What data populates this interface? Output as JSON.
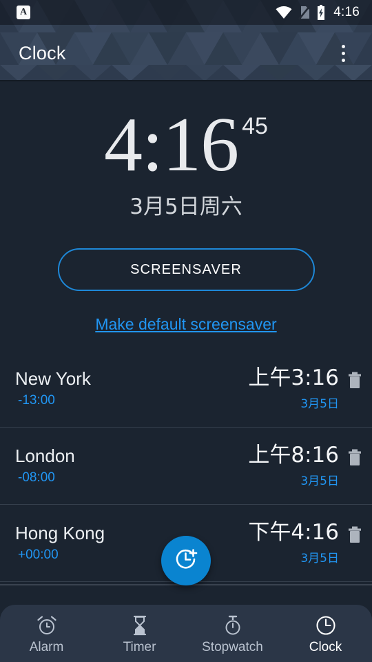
{
  "statusbar": {
    "app_icon": "app-letter-a-icon",
    "icons": [
      "wifi-icon",
      "sim-card-off-icon",
      "battery-charging-icon"
    ],
    "time": "4:16"
  },
  "appbar": {
    "title": "Clock",
    "overflow": "overflow-menu-icon"
  },
  "main_clock": {
    "time": "4:16",
    "seconds": "45",
    "date": "3月5日周六",
    "screensaver_label": "SCREENSAVER",
    "make_default_label": "Make default screensaver"
  },
  "fab": {
    "icon": "add-clock-icon"
  },
  "cities": [
    {
      "name": "New York",
      "offset": "-13:00",
      "time": "上午3:16",
      "date": "3月5日",
      "delete_icon": "trash-icon"
    },
    {
      "name": "London",
      "offset": "-08:00",
      "time": "上午8:16",
      "date": "3月5日",
      "delete_icon": "trash-icon"
    },
    {
      "name": "Hong Kong",
      "offset": "+00:00",
      "time": "下午4:16",
      "date": "3月5日",
      "delete_icon": "trash-icon"
    }
  ],
  "bottom_nav": {
    "items": [
      {
        "label": "Alarm",
        "icon": "alarm-icon",
        "active": false
      },
      {
        "label": "Timer",
        "icon": "hourglass-icon",
        "active": false
      },
      {
        "label": "Stopwatch",
        "icon": "stopwatch-icon",
        "active": false
      },
      {
        "label": "Clock",
        "icon": "clock-icon",
        "active": true
      }
    ]
  },
  "colors": {
    "background": "#1b2430",
    "accent": "#2196f3",
    "fab": "#0a84d0",
    "appbar": "#2e3b4e",
    "nav_bar": "#2b3647"
  }
}
